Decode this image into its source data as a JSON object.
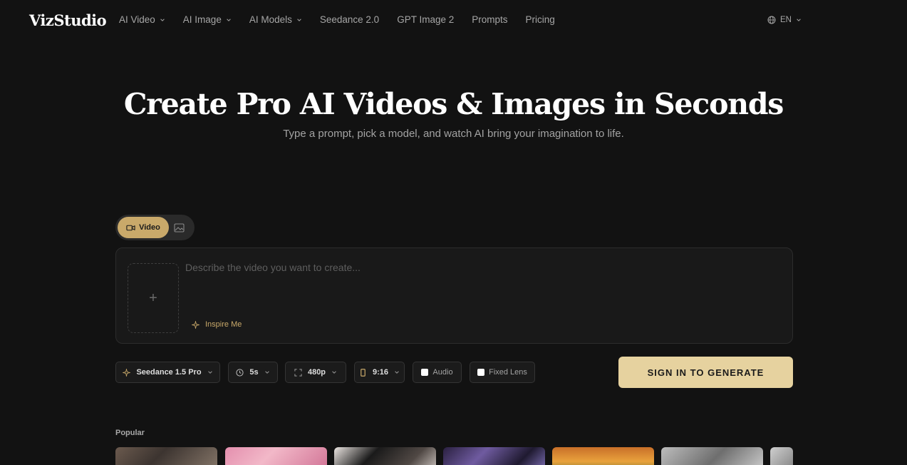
{
  "header": {
    "logo": "VizStudio",
    "nav": [
      {
        "label": "AI Video",
        "dropdown": true
      },
      {
        "label": "AI Image",
        "dropdown": true
      },
      {
        "label": "AI Models",
        "dropdown": true
      },
      {
        "label": "Seedance 2.0",
        "dropdown": false
      },
      {
        "label": "GPT Image 2",
        "dropdown": false
      },
      {
        "label": "Prompts",
        "dropdown": false
      },
      {
        "label": "Pricing",
        "dropdown": false
      }
    ],
    "language": "EN"
  },
  "hero": {
    "title": "Create Pro AI Videos & Images in Seconds",
    "subtitle": "Type a prompt, pick a model, and watch AI bring your imagination to life."
  },
  "mode": {
    "video_label": "Video",
    "active": "video",
    "icons": {
      "video": "video-camera-icon",
      "image": "image-icon"
    }
  },
  "prompt": {
    "placeholder": "Describe the video you want to create...",
    "value": "",
    "inspire_label": "Inspire Me",
    "upload_symbol": "+"
  },
  "controls": {
    "model": "Seedance 1.5 Pro",
    "duration": "5s",
    "resolution": "480p",
    "aspect_ratio": "9:16",
    "audio_label": "Audio",
    "audio_checked": false,
    "fixed_lens_label": "Fixed Lens",
    "fixed_lens_checked": false
  },
  "generate_label": "SIGN IN TO GENERATE",
  "popular": {
    "label": "Popular",
    "thumbnail_count": 7
  },
  "colors": {
    "background": "#121212",
    "accent": "#c9a96a",
    "generate_button": "#e6d29f"
  }
}
